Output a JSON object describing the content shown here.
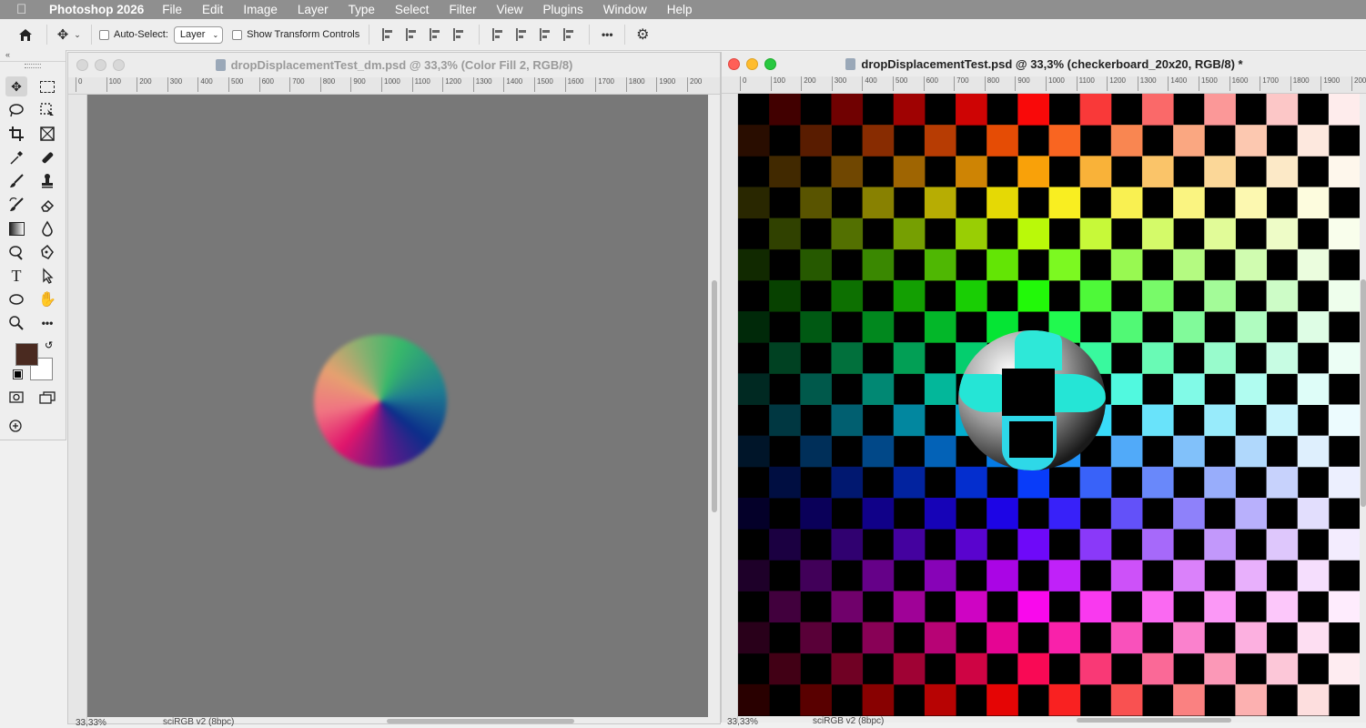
{
  "menubar": {
    "app_name": "Photoshop 2026",
    "items": [
      "File",
      "Edit",
      "Image",
      "Layer",
      "Type",
      "Select",
      "Filter",
      "View",
      "Plugins",
      "Window",
      "Help"
    ]
  },
  "options": {
    "auto_select_label": "Auto-Select:",
    "auto_select_value": "Layer",
    "show_transform_label": "Show Transform Controls",
    "more_label": "•••"
  },
  "colors": {
    "foreground": "#4a2a20",
    "background": "#ffffff",
    "canvas_gray": "#787878"
  },
  "left_doc": {
    "title": "dropDisplacementTest_dm.psd @ 33,3% (Color Fill 2, RGB/8)",
    "ruler_labels": [
      "0",
      "100",
      "200",
      "300",
      "400",
      "500",
      "600",
      "700",
      "800",
      "900",
      "1000",
      "1100",
      "1200",
      "1300",
      "1400",
      "1500",
      "1600",
      "1700",
      "1800",
      "1900",
      "200"
    ],
    "status_zoom": "33,33%",
    "status_profile": "sciRGB v2 (8bpc)"
  },
  "right_doc": {
    "title": "dropDisplacementTest.psd @ 33,3% (checkerboard_20x20, RGB/8) *",
    "ruler_labels": [
      "0",
      "100",
      "200",
      "300",
      "400",
      "500",
      "600",
      "700",
      "800",
      "900",
      "1000",
      "1100",
      "1200",
      "1300",
      "1400",
      "1500",
      "1600",
      "1700",
      "1800",
      "1900",
      "200"
    ],
    "status_zoom": "33,33%",
    "status_profile": "sciRGB v2 (8bpc)"
  }
}
